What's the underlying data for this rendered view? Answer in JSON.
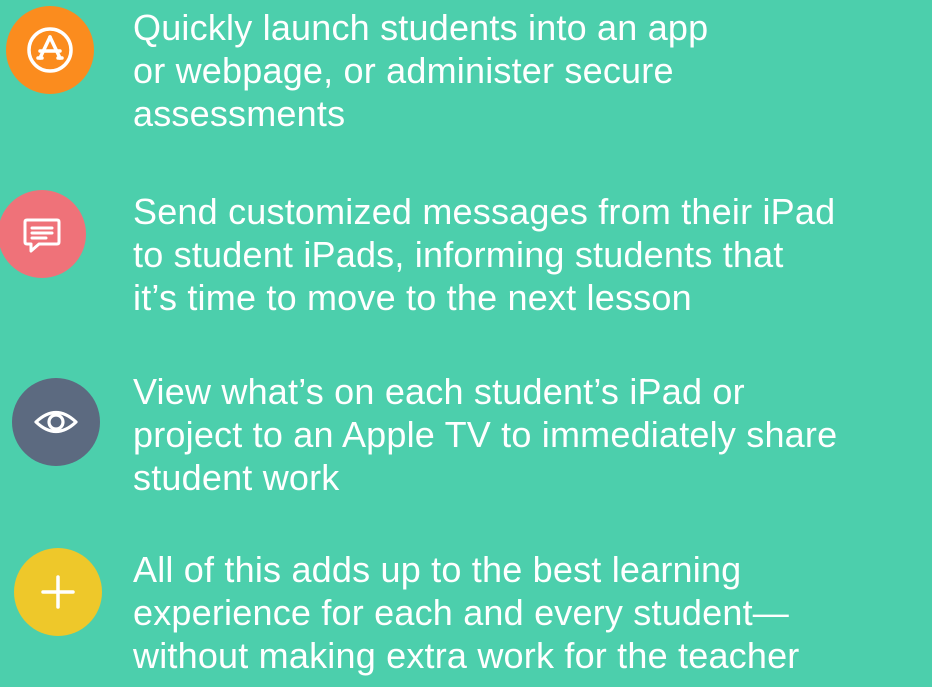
{
  "features": [
    {
      "icon": "app-store-icon",
      "color": "#fb8c1e",
      "text": "Quickly launch students into an app\nor webpage, or administer secure\nassessments"
    },
    {
      "icon": "message-icon",
      "color": "#ef7279",
      "text": "Send customized messages from their iPad\nto student iPads, informing students that\nit’s time to move to the next lesson"
    },
    {
      "icon": "eye-icon",
      "color": "#5c6a80",
      "text": "View what’s on each student’s iPad or\nproject to an Apple TV to immediately share\nstudent work"
    },
    {
      "icon": "plus-icon",
      "color": "#eec82a",
      "text": "All of this adds up to the best learning\nexperience for each and every student—\nwithout making extra work for the teacher"
    }
  ]
}
